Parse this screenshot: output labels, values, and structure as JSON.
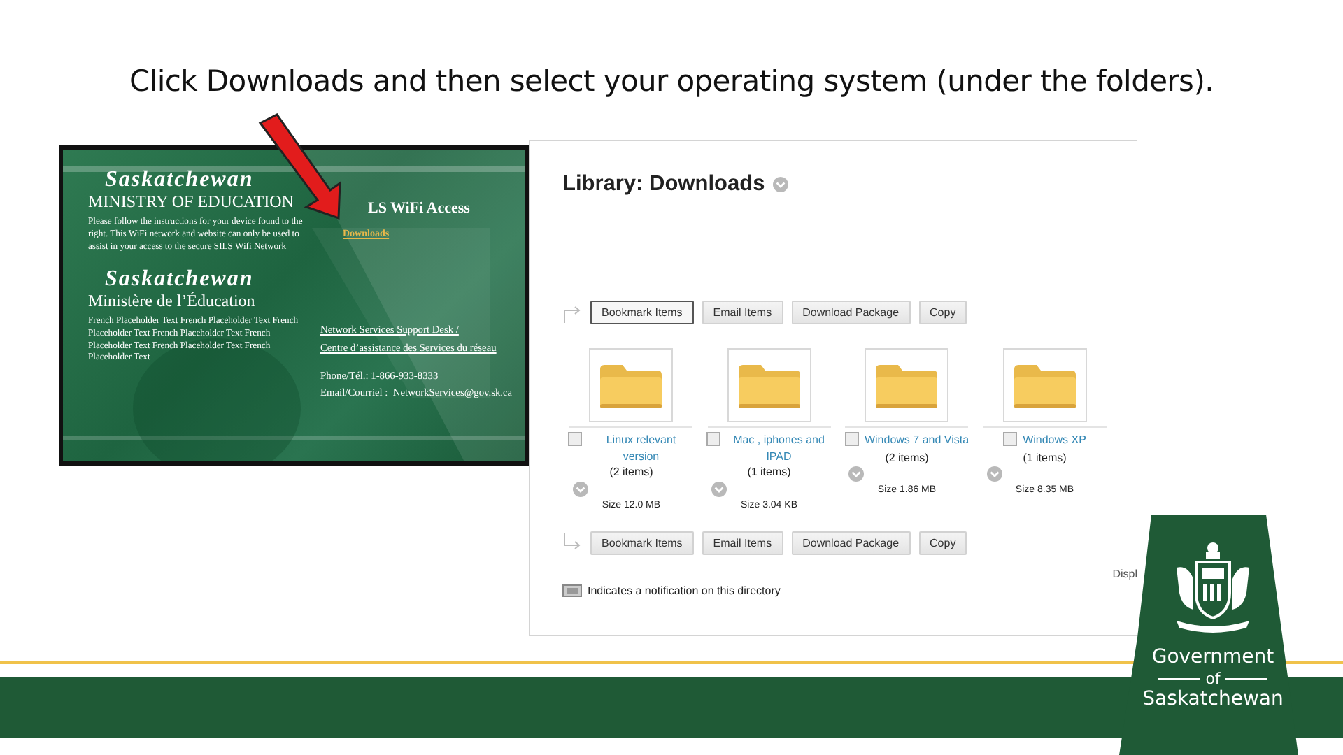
{
  "slide": {
    "instruction": "Click Downloads and then select your operating system (under the folders)."
  },
  "wifi_page": {
    "heading_en": "Saskatchewan",
    "ministry_en": "MINISTRY OF EDUCATION",
    "intro": "Please follow the instructions for your device found to the right. This WiFi network and website can only be used to assist in your access to the secure SILS Wifi Network",
    "heading_fr": "Saskatchewan",
    "ministry_fr": "Ministère de l’Éducation",
    "french_text": "French Placeholder Text French Placeholder Text French Placeholder Text French Placeholder Text French Placeholder Text French Placeholder Text French Placeholder Text",
    "title": "LS WiFi Access",
    "downloads_link": "Downloads",
    "support_links": [
      "Network Services Support Desk /",
      "Centre d’assistance des Services du réseau"
    ],
    "phone": "Phone/Tél.: 1-866-933-8333",
    "email": "Email/Courriel :  NetworkServices@gov.sk.ca"
  },
  "library": {
    "title": "Library: Downloads",
    "top_buttons": [
      {
        "label": "Bookmark Items",
        "selected": true
      },
      {
        "label": "Email Items",
        "selected": false
      },
      {
        "label": "Download Package",
        "selected": false
      },
      {
        "label": "Copy",
        "selected": false
      }
    ],
    "folders": [
      {
        "name": "Linux relevant version",
        "count": "(2 items)",
        "size": "Size 12.0 MB",
        "checked": false
      },
      {
        "name": "Mac , iphones and IPAD",
        "count": "(1 items)",
        "size": "Size 3.04 KB",
        "checked": false
      },
      {
        "name": "Windows 7 and Vista",
        "count": "(2 items)",
        "size": "Size 1.86 MB",
        "checked": false
      },
      {
        "name": "Windows XP",
        "count": "(1 items)",
        "size": "Size 8.35 MB",
        "checked": false
      }
    ],
    "bottom_buttons": [
      {
        "label": "Bookmark Items",
        "selected": false
      },
      {
        "label": "Email Items",
        "selected": false
      },
      {
        "label": "Download Package",
        "selected": false
      },
      {
        "label": "Copy",
        "selected": false
      }
    ],
    "display_label": "Displ",
    "legend": "Indicates a notification on this directory"
  },
  "logo": {
    "line1": "Government",
    "line2": "of",
    "line3": "Saskatchewan"
  }
}
